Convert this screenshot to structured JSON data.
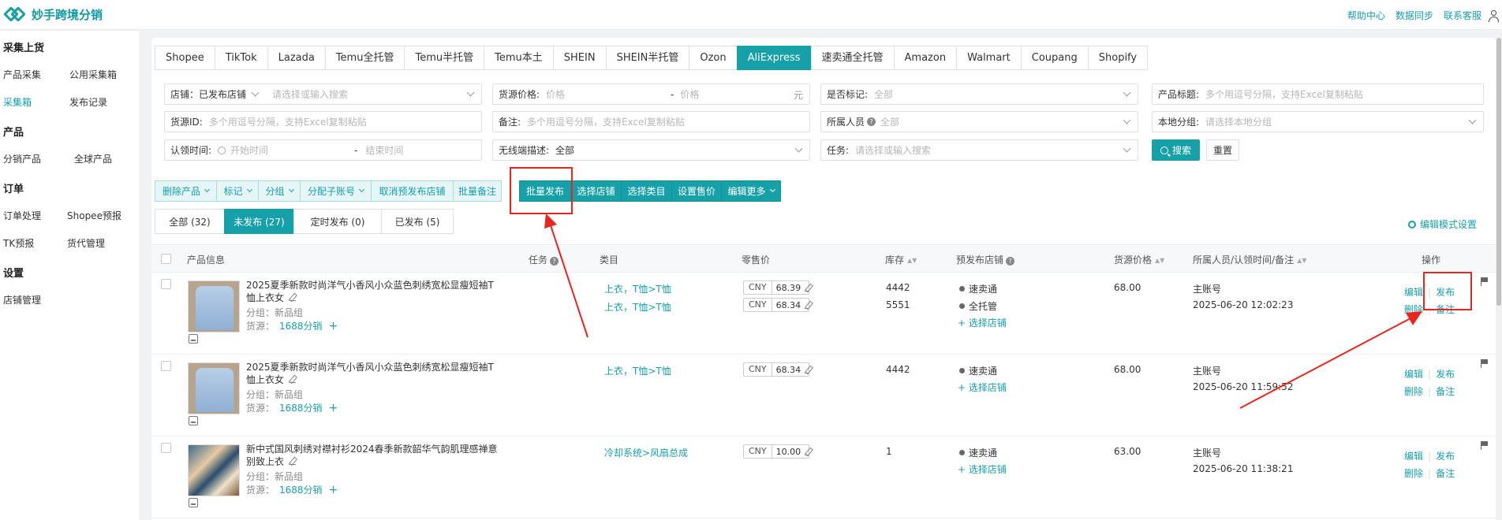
{
  "app": {
    "name": "妙手跨境分销"
  },
  "top_links": [
    "帮助中心",
    "数据同步",
    "联系客服"
  ],
  "sidebar": {
    "groups": [
      "采集上货",
      "产品",
      "订单",
      "设置"
    ],
    "items": [
      "产品采集",
      "公用采集箱",
      "采集箱",
      "发布记录",
      "分销产品",
      "全球产品",
      "订单处理",
      "Shopee预报",
      "TK预报",
      "货代管理",
      "店铺管理"
    ]
  },
  "platform_tabs": [
    "Shopee",
    "TikTok",
    "Lazada",
    "Temu全托管",
    "Temu半托管",
    "Temu本土",
    "SHEIN",
    "SHEIN半托管",
    "Ozon",
    "AliExpress",
    "速卖通全托管",
    "Amazon",
    "Walmart",
    "Coupang",
    "Shopify"
  ],
  "filters": {
    "store": {
      "label": "店铺：已发布店铺",
      "placeholder": "请选择或输入搜索"
    },
    "price": {
      "label": "货源价格:",
      "min_ph": "价格",
      "sep": "-",
      "max_ph": "价格",
      "unit": "元"
    },
    "marked": {
      "label": "是否标记:",
      "value": "全部"
    },
    "title": {
      "label": "产品标题:",
      "placeholder": "多个用逗号分隔，支持Excel复制粘贴"
    },
    "source_id": {
      "label": "货源ID:",
      "placeholder": "多个用逗号分隔，支持Excel复制粘贴"
    },
    "remark": {
      "label": "备注:",
      "placeholder": "多个用逗号分隔，支持Excel复制粘贴"
    },
    "owner": {
      "label": "所属人员",
      "value": "全部"
    },
    "local_group": {
      "label": "本地分组:",
      "placeholder": "请选择本地分组"
    },
    "claim_time": {
      "label": "认领时间:",
      "start_ph": "开始时间",
      "sep": "-",
      "end_ph": "结束时间"
    },
    "wireless": {
      "label": "无线端描述:",
      "value": "全部"
    },
    "task": {
      "label": "任务:",
      "placeholder": "请选择或输入搜索"
    },
    "search_btn": "搜索",
    "reset_btn": "重置"
  },
  "actions": [
    "删除产品",
    "标记",
    "分组",
    "分配子账号",
    "取消预发布店铺",
    "批量备注",
    "批量发布",
    "选择店铺",
    "选择类目",
    "设置售价",
    "编辑更多"
  ],
  "status_tabs": [
    "全部 (32)",
    "未发布 (27)",
    "定时发布 (0)",
    "已发布 (5)"
  ],
  "edit_mode": "编辑模式设置",
  "table": {
    "headers": [
      "产品信息",
      "任务",
      "类目",
      "零售价",
      "库存",
      "预发布店铺",
      "货源价格",
      "所属人员/认领时间/备注",
      "操作"
    ],
    "rows": [
      {
        "title": "2025夏季新款时尚洋气小香风小众蓝色刺绣宽松显瘦短袖T恤上衣女",
        "group": "分组：新品组",
        "source_label": "货源：",
        "source": "1688分销",
        "categories": [
          "上衣，T恤>T恤",
          "上衣，T恤>T恤"
        ],
        "prices": [
          {
            "cur": "CNY",
            "val": "68.39"
          },
          {
            "cur": "CNY",
            "val": "68.34"
          }
        ],
        "stock": [
          "4442",
          "5551"
        ],
        "stores": [
          "速卖通",
          "全托管"
        ],
        "add_store": "选择店铺",
        "source_price": "68.00",
        "owner": "主账号",
        "time": "2025-06-20 12:02:23",
        "ops": [
          "编辑",
          "发布",
          "删除",
          "备注"
        ]
      },
      {
        "title": "2025夏季新款时尚洋气小香风小众蓝色刺绣宽松显瘦短袖T恤上衣女",
        "group": "分组：新品组",
        "source_label": "货源：",
        "source": "1688分销",
        "categories": [
          "上衣，T恤>T恤"
        ],
        "prices": [
          {
            "cur": "CNY",
            "val": "68.34"
          }
        ],
        "stock": [
          "4442"
        ],
        "stores": [
          "速卖通"
        ],
        "add_store": "选择店铺",
        "source_price": "68.00",
        "owner": "主账号",
        "time": "2025-06-20 11:59:52",
        "ops": [
          "编辑",
          "发布",
          "删除",
          "备注"
        ]
      },
      {
        "title": "新中式国风刺绣对襟衬衫2024春季新款韶华气韵肌理感禅意别致上衣",
        "group": "分组：新品组",
        "source_label": "货源：",
        "source": "1688分销",
        "categories": [
          "冷却系统>风扇总成"
        ],
        "prices": [
          {
            "cur": "CNY",
            "val": "10.00"
          }
        ],
        "stock": [
          "1"
        ],
        "stores": [
          "速卖通"
        ],
        "add_store": "选择店铺",
        "source_price": "63.00",
        "owner": "主账号",
        "time": "2025-06-20 11:38:21",
        "ops": [
          "编辑",
          "发布",
          "删除",
          "备注"
        ]
      }
    ]
  },
  "colors": {
    "accent": "#16a0a8",
    "annotation": "#e8261d"
  },
  "icons": [
    "logo-icon",
    "user-icon",
    "search-icon",
    "gear-icon",
    "edit-pen-icon",
    "flag-icon",
    "chevron-down-icon",
    "help-icon",
    "sort-icon"
  ]
}
